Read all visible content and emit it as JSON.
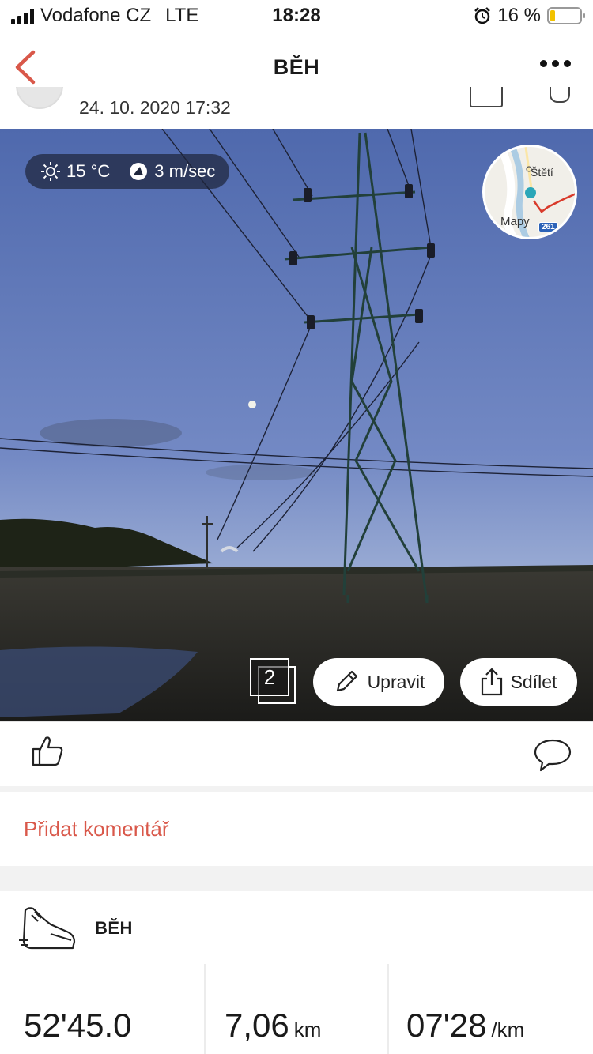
{
  "status_bar": {
    "carrier": "Vodafone CZ",
    "network": "LTE",
    "time": "18:28",
    "battery_percent": "16 %",
    "battery_level": 0.16
  },
  "nav": {
    "title": "BĚH"
  },
  "post": {
    "date": "24. 10. 2020 17:32"
  },
  "weather": {
    "temperature": "15 °C",
    "wind": "3 m/sec"
  },
  "map": {
    "city": "Štětí",
    "maps_label": "Mapy",
    "road_badge": "261"
  },
  "photo": {
    "count": "2",
    "edit_label": "Upravit",
    "share_label": "Sdílet"
  },
  "comments": {
    "add_label": "Přidat komentář"
  },
  "activity": {
    "title": "BĚH",
    "stats": [
      {
        "value": "52'45.0",
        "unit": ""
      },
      {
        "value": "7,06",
        "unit": "km"
      },
      {
        "value": "07'28",
        "unit": "/km"
      }
    ]
  },
  "colors": {
    "accent": "#d9584a",
    "sky_top": "#4f69ad",
    "sky_bottom": "#9fb0d6",
    "route": "#d93a2b",
    "map_dot": "#2aa6b8"
  }
}
